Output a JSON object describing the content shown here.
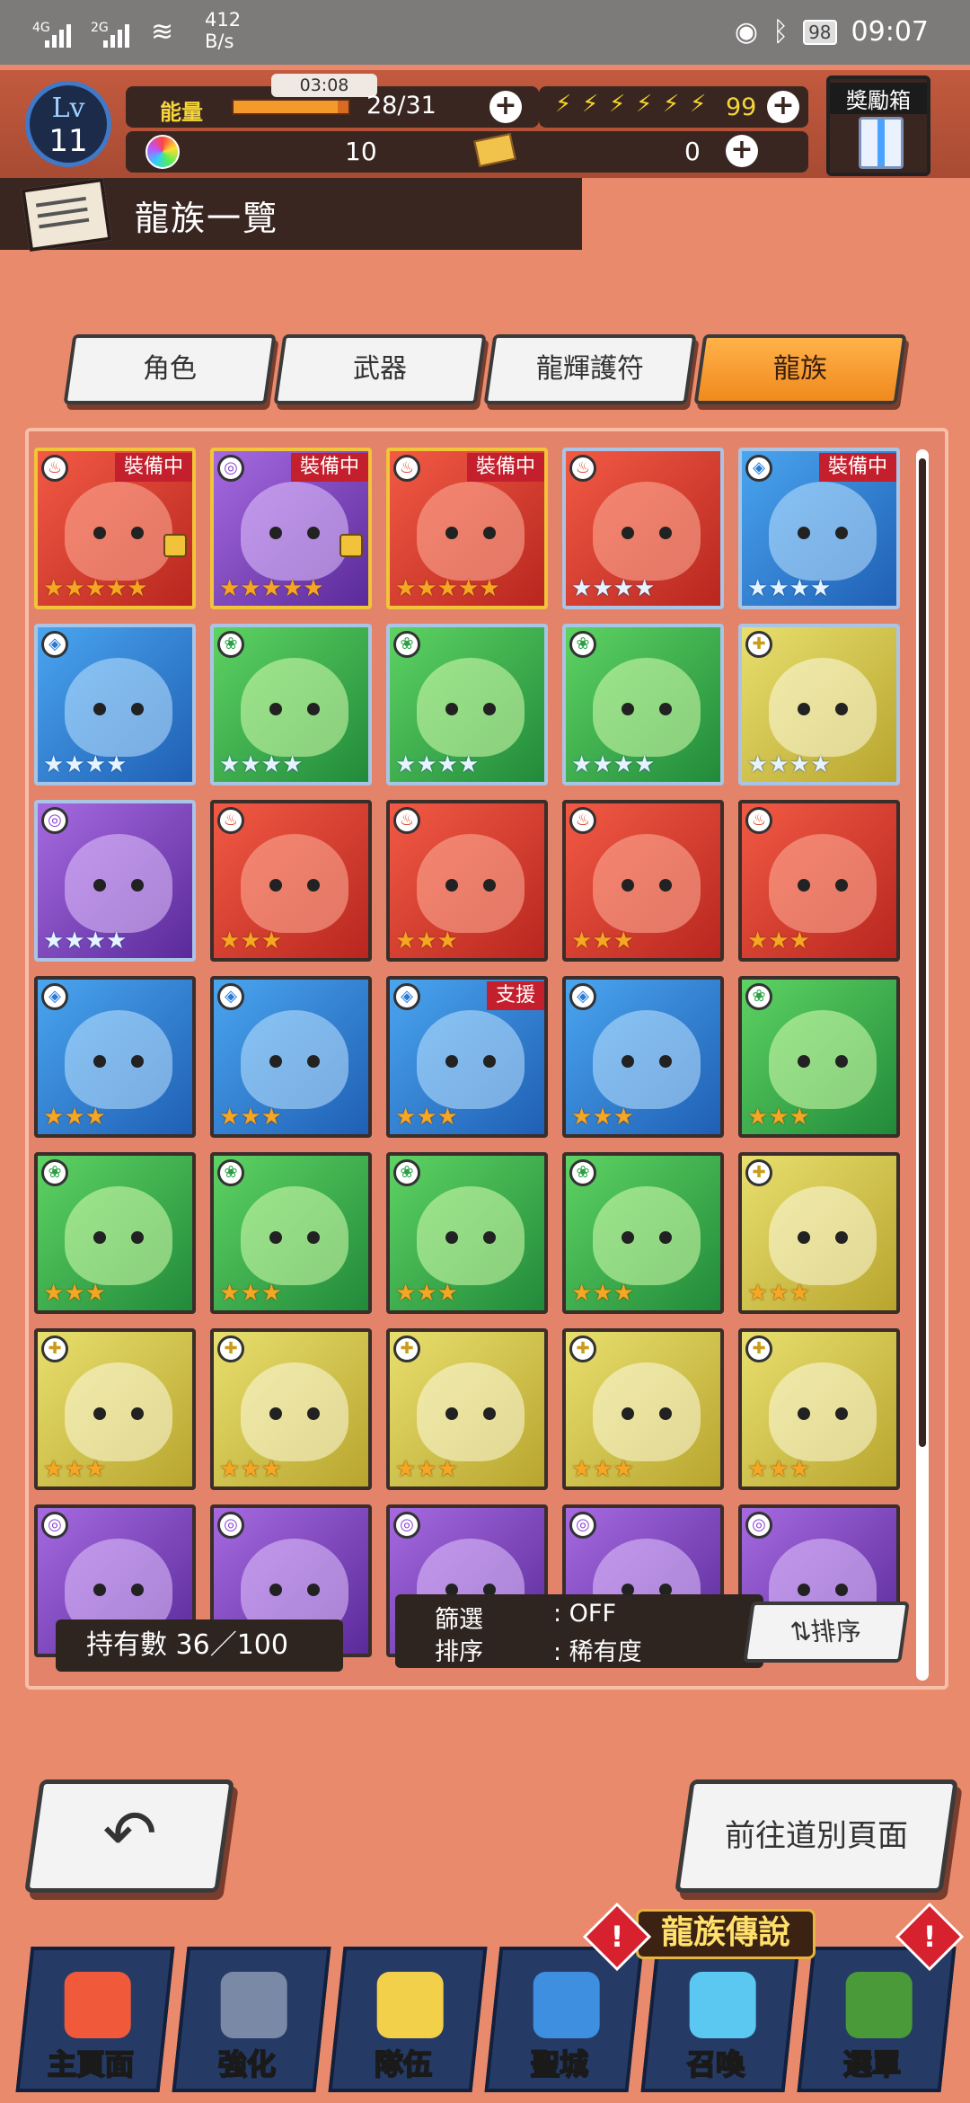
{
  "status": {
    "signal1": "4G",
    "signal2": "2G",
    "netspeed_value": "412",
    "netspeed_unit": "B/s",
    "battery": "98",
    "time": "09:07"
  },
  "player": {
    "lv_label": "Lv",
    "level": "11",
    "energy_label": "能量",
    "energy_text": "28/31",
    "energy_fraction": 0.903,
    "timer": "03:08",
    "bolt_count": "99",
    "gem_count": "10",
    "ticket_count": "0",
    "reward_label": "獎勵箱"
  },
  "header": {
    "title": "龍族一覽"
  },
  "tabs": [
    {
      "label": "角色",
      "active": false
    },
    {
      "label": "武器",
      "active": false
    },
    {
      "label": "龍輝護符",
      "active": false
    },
    {
      "label": "龍族",
      "active": true
    }
  ],
  "dragons": [
    {
      "element": "fire",
      "stars": 5,
      "badge": "裝備中",
      "locked": true
    },
    {
      "element": "dark",
      "stars": 5,
      "badge": "裝備中",
      "locked": true
    },
    {
      "element": "fire",
      "stars": 5,
      "badge": "裝備中",
      "locked": false
    },
    {
      "element": "fire",
      "stars": 4,
      "badge": "",
      "locked": false
    },
    {
      "element": "water",
      "stars": 4,
      "badge": "裝備中",
      "locked": false
    },
    {
      "element": "water",
      "stars": 4,
      "badge": "",
      "locked": false
    },
    {
      "element": "wind",
      "stars": 4,
      "badge": "",
      "locked": false
    },
    {
      "element": "wind",
      "stars": 4,
      "badge": "",
      "locked": false
    },
    {
      "element": "wind",
      "stars": 4,
      "badge": "",
      "locked": false
    },
    {
      "element": "light",
      "stars": 4,
      "badge": "",
      "locked": false
    },
    {
      "element": "dark",
      "stars": 4,
      "badge": "",
      "locked": false
    },
    {
      "element": "fire",
      "stars": 3,
      "badge": "",
      "locked": false
    },
    {
      "element": "fire",
      "stars": 3,
      "badge": "",
      "locked": false
    },
    {
      "element": "fire",
      "stars": 3,
      "badge": "",
      "locked": false
    },
    {
      "element": "fire",
      "stars": 3,
      "badge": "",
      "locked": false
    },
    {
      "element": "water",
      "stars": 3,
      "badge": "",
      "locked": false
    },
    {
      "element": "water",
      "stars": 3,
      "badge": "",
      "locked": false
    },
    {
      "element": "water",
      "stars": 3,
      "badge": "支援",
      "locked": false
    },
    {
      "element": "water",
      "stars": 3,
      "badge": "",
      "locked": false
    },
    {
      "element": "wind",
      "stars": 3,
      "badge": "",
      "locked": false
    },
    {
      "element": "wind",
      "stars": 3,
      "badge": "",
      "locked": false
    },
    {
      "element": "wind",
      "stars": 3,
      "badge": "",
      "locked": false
    },
    {
      "element": "wind",
      "stars": 3,
      "badge": "",
      "locked": false
    },
    {
      "element": "wind",
      "stars": 3,
      "badge": "",
      "locked": false
    },
    {
      "element": "light",
      "stars": 3,
      "badge": "",
      "locked": false
    },
    {
      "element": "light",
      "stars": 3,
      "badge": "",
      "locked": false
    },
    {
      "element": "light",
      "stars": 3,
      "badge": "",
      "locked": false
    },
    {
      "element": "light",
      "stars": 3,
      "badge": "",
      "locked": false
    },
    {
      "element": "light",
      "stars": 3,
      "badge": "",
      "locked": false
    },
    {
      "element": "light",
      "stars": 3,
      "badge": "",
      "locked": false
    },
    {
      "element": "dark",
      "stars": 0,
      "badge": "",
      "locked": false
    },
    {
      "element": "dark",
      "stars": 0,
      "badge": "",
      "locked": false
    },
    {
      "element": "dark",
      "stars": 0,
      "badge": "",
      "locked": false
    },
    {
      "element": "dark",
      "stars": 0,
      "badge": "",
      "locked": false
    },
    {
      "element": "dark",
      "stars": 0,
      "badge": "",
      "locked": false
    }
  ],
  "footer_info": {
    "owned": "持有數 36／100",
    "filter_label": "篩選",
    "filter_value": ": OFF",
    "sort_label": "排序",
    "sort_value": ": 稀有度",
    "sort_button": "排序"
  },
  "actions": {
    "back": "↶",
    "go_page": "前往道別頁面"
  },
  "legend_banner": "龍族傳說",
  "nav": [
    {
      "label": "主頁面",
      "alert": false,
      "color": "#f05a3a"
    },
    {
      "label": "強化",
      "alert": false,
      "color": "#7a8aa6"
    },
    {
      "label": "隊伍",
      "alert": false,
      "color": "#f2d04a"
    },
    {
      "label": "聖城",
      "alert": true,
      "color": "#3f8fe0"
    },
    {
      "label": "召喚",
      "alert": false,
      "color": "#5ac8f0"
    },
    {
      "label": "選單",
      "alert": true,
      "color": "#4a9a3a"
    }
  ],
  "icons": {
    "wifi": "wifi-icon",
    "eye": "eye-icon",
    "bluetooth": "bluetooth-icon",
    "plus": "plus-icon",
    "bolt": "bolt-icon",
    "gem": "gem-icon",
    "ticket": "ticket-icon",
    "gift": "gift-icon",
    "lock": "lock-icon"
  }
}
